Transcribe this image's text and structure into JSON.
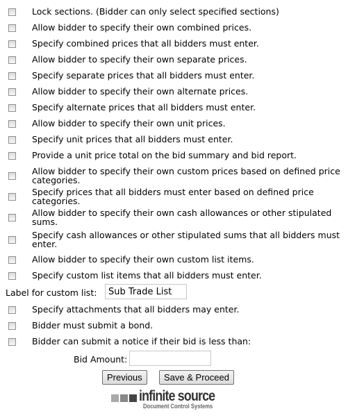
{
  "options": [
    {
      "label": "Lock sections. (Bidder can only select specified sections)",
      "checked": false
    },
    {
      "label": "Allow bidder to specify their own combined prices.",
      "checked": false
    },
    {
      "label": "Specify combined prices that all bidders must enter.",
      "checked": false
    },
    {
      "label": "Allow bidder to specify their own separate prices.",
      "checked": false
    },
    {
      "label": "Specify separate prices that all bidders must enter.",
      "checked": false
    },
    {
      "label": "Allow bidder to specify their own alternate prices.",
      "checked": false
    },
    {
      "label": "Specify alternate prices that all bidders must enter.",
      "checked": false
    },
    {
      "label": "Allow bidder to specify their own unit prices.",
      "checked": false
    },
    {
      "label": "Specify unit prices that all bidders must enter.",
      "checked": false
    },
    {
      "label": "Provide a unit price total on the bid summary and bid report.",
      "checked": false
    },
    {
      "label": "Allow bidder to specify their own custom prices based on defined price categories.",
      "checked": false
    },
    {
      "label": "Specify prices that all bidders must enter based on defined price categories.",
      "checked": false
    },
    {
      "label": "Allow bidder to specify their own cash allowances or other stipulated sums.",
      "checked": false
    },
    {
      "label": "Specify cash allowances or other stipulated sums that all bidders must enter.",
      "checked": false
    },
    {
      "label": "Allow bidder to specify their own custom list items.",
      "checked": false
    },
    {
      "label": "Specify custom list items that all bidders must enter.",
      "checked": false
    }
  ],
  "custom_list": {
    "label": "Label for custom list:",
    "value": "Sub Trade List"
  },
  "options2": [
    {
      "label": "Specify attachments that all bidders may enter.",
      "checked": false
    },
    {
      "label": "Bidder must submit a bond.",
      "checked": false
    },
    {
      "label": "Bidder can submit a notice if their bid is less than:",
      "checked": false
    }
  ],
  "bid_amount": {
    "label": "Bid Amount:",
    "value": ""
  },
  "buttons": {
    "previous": "Previous",
    "save": "Save & Proceed"
  },
  "logo": {
    "name": "infinite source",
    "tagline": "Document Control Systems"
  }
}
